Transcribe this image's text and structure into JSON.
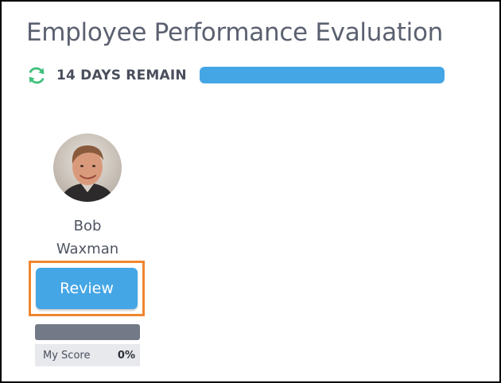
{
  "evaluation": {
    "title": "Employee Performance Evaluation",
    "days_remaining_text": "14 DAYS REMAIN",
    "days_progress": 1.0,
    "accent_color": "#45a6e6",
    "refresh_icon": "refresh-icon",
    "refresh_icon_color": "#3fc07a"
  },
  "employee": {
    "first_name": "Bob",
    "last_name": "Waxman",
    "avatar_icon": "employee-avatar",
    "review_label": "Review",
    "review_highlight_color": "#f0852f",
    "score_progress": 0,
    "score_label": "My Score",
    "score_value": "0%"
  }
}
